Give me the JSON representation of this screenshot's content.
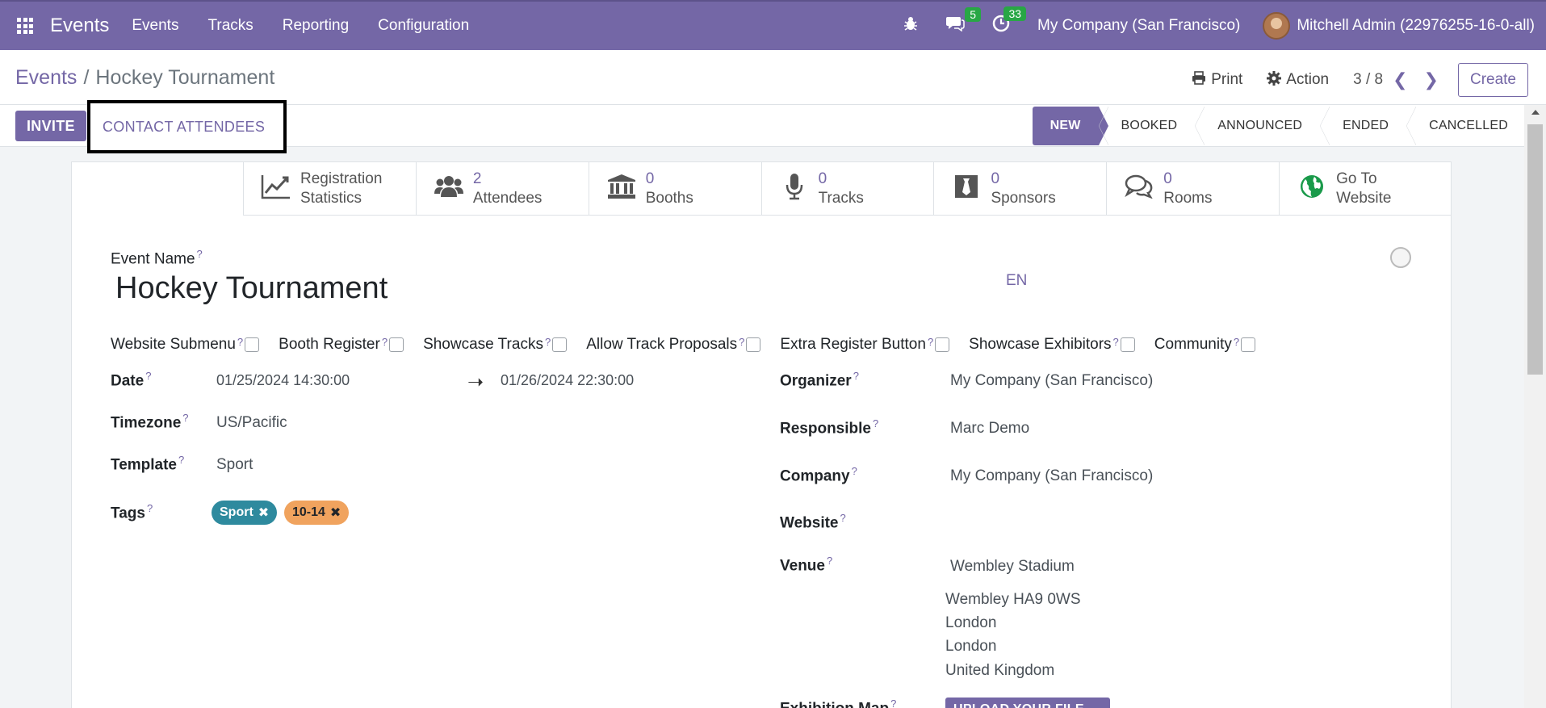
{
  "navbar": {
    "app_name": "Events",
    "menu": [
      "Events",
      "Tracks",
      "Reporting",
      "Configuration"
    ],
    "messages_count": "5",
    "activities_count": "33",
    "company": "My Company (San Francisco)",
    "user": "Mitchell Admin (22976255-16-0-all)",
    "accent_color": "#7467a6"
  },
  "control_panel": {
    "breadcrumb_root": "Events",
    "breadcrumb_sep": "/",
    "breadcrumb_current": "Hockey Tournament",
    "print_label": "Print",
    "action_label": "Action",
    "pager": "3 / 8",
    "create_label": "Create"
  },
  "statusbar": {
    "invite_label": "INVITE",
    "contact_label": "CONTACT ATTENDEES",
    "stages": [
      "NEW",
      "BOOKED",
      "ANNOUNCED",
      "ENDED",
      "CANCELLED"
    ],
    "active_stage": "NEW"
  },
  "smart_buttons": [
    {
      "icon": "chart-line-icon",
      "value": "",
      "label": "Registration",
      "label2": "Statistics"
    },
    {
      "icon": "users-icon",
      "value": "2",
      "label": "Attendees"
    },
    {
      "icon": "bank-icon",
      "value": "0",
      "label": "Booths"
    },
    {
      "icon": "microphone-icon",
      "value": "0",
      "label": "Tracks"
    },
    {
      "icon": "black-tie-icon",
      "value": "0",
      "label": "Sponsors"
    },
    {
      "icon": "comments-icon",
      "value": "0",
      "label": "Rooms"
    },
    {
      "icon": "globe-icon",
      "value": "",
      "label": "Go To",
      "label2": "Website"
    }
  ],
  "form": {
    "event_name_label": "Event Name",
    "event_name": "Hockey Tournament",
    "lang": "EN",
    "help_mark": "?",
    "checkboxes": [
      "Website Submenu",
      "Booth Register",
      "Showcase Tracks",
      "Allow Track Proposals",
      "Extra Register Button",
      "Showcase Exhibitors",
      "Community"
    ],
    "date_label": "Date",
    "date_start": "01/25/2024 14:30:00",
    "date_end": "01/26/2024 22:30:00",
    "timezone_label": "Timezone",
    "timezone": "US/Pacific",
    "template_label": "Template",
    "template": "Sport",
    "tags_label": "Tags",
    "tags": [
      "Sport",
      "10-14"
    ],
    "organizer_label": "Organizer",
    "organizer": "My Company (San Francisco)",
    "responsible_label": "Responsible",
    "responsible": "Marc Demo",
    "company_label": "Company",
    "company": "My Company (San Francisco)",
    "website_label": "Website",
    "venue_label": "Venue",
    "venue": "Wembley Stadium",
    "venue_address": [
      "Wembley HA9 0WS",
      "London",
      "London",
      "United Kingdom"
    ],
    "exhibition_map_label": "Exhibition Map",
    "upload_label": "UPLOAD YOUR FILE"
  }
}
